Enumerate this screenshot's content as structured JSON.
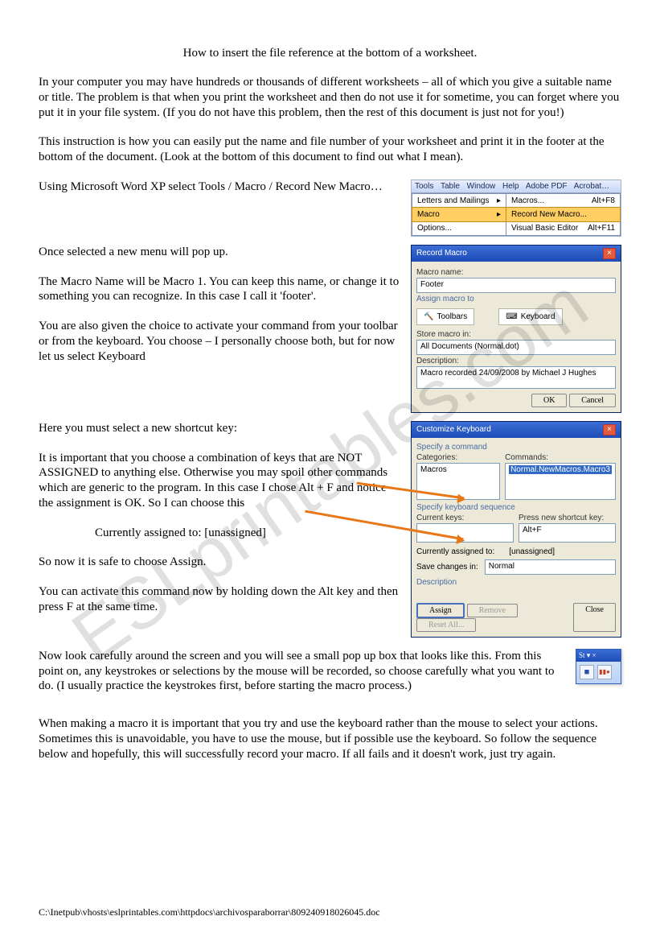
{
  "title": "How to insert the file reference at the bottom of a worksheet.",
  "p1": "In your computer you may have hundreds or thousands of different worksheets – all of which you give a suitable name or title.  The problem is that when you print the worksheet and then do not use it for sometime, you can forget where you put it in your file system.  (If you do not have this problem, then the rest of this document is just not for you!)",
  "p2": "This instruction is how you can easily put the name and file number of your worksheet and print it in the footer at the bottom of the document. (Look at the bottom of this document to find out what I mean).",
  "p3": "Using Microsoft Word XP select Tools / Macro / Record New Macro…",
  "p4": "Once selected a new menu will pop up.",
  "p5": "The Macro Name will be Macro 1.  You can keep this name, or change it to something you can recognize.  In this case I call it 'footer'.",
  "p6": "You are also given the choice to activate your command from your toolbar or from the keyboard.  You choose – I personally choose both, but for now let us select Keyboard",
  "p7": "Here you must select a new shortcut key:",
  "p8": "It is important that you choose a combination of keys that are NOT ASSIGNED to anything else.  Otherwise you may spoil other commands which are generic to the program.  In this case I chose Alt + F and notice the assignment is OK.  So I can choose this",
  "p8b": "Currently assigned to:  [unassigned]",
  "p9": "So now it is safe to choose Assign.",
  "p10": "You can activate this command now by holding down the Alt key and then press F at the same time.",
  "p11": "Now look carefully around the screen and you will see a small pop up box that looks like this.  From this point on, any keystrokes or selections by the mouse will be recorded, so choose carefully what you want to do. (I usually practice the keystrokes first, before starting the macro process.)",
  "p12": "When making a macro it is important that you try and use the keyboard rather than the mouse to select your actions.  Sometimes this is unavoidable, you have to use the mouse, but if possible use the keyboard.  So follow the sequence below and hopefully, this will successfully record your macro.  If all fails and it doesn't work, just try again.",
  "footer_path": "C:\\Inetpub\\vhosts\\eslprintables.com\\httpdocs\\archivosparaborrar\\809240918026045.doc",
  "watermark": "ESLprintables.com",
  "shot1": {
    "menubar": [
      "Tools",
      "Table",
      "Window",
      "Help",
      "Adobe PDF",
      "Acrobat…"
    ],
    "menu": [
      {
        "label": "Letters and Mailings",
        "arrow": "▸"
      },
      {
        "label": "Macro",
        "arrow": "▸",
        "hl": true
      },
      {
        "label": "Options..."
      }
    ],
    "submenu": [
      {
        "label": "Macros...",
        "sc": "Alt+F8"
      },
      {
        "label": "Record New Macro...",
        "hl": true
      },
      {
        "label": "Visual Basic Editor",
        "sc": "Alt+F11"
      }
    ]
  },
  "shot2": {
    "title": "Record Macro",
    "macro_name_label": "Macro name:",
    "macro_name_value": "Footer",
    "assign_label": "Assign macro to",
    "toolbars": "Toolbars",
    "keyboard": "Keyboard",
    "store_label": "Store macro in:",
    "store_value": "All Documents (Normal.dot)",
    "desc_label": "Description:",
    "desc_value": "Macro recorded 24/09/2008 by Michael J Hughes",
    "ok": "OK",
    "cancel": "Cancel"
  },
  "shot3": {
    "title": "Customize Keyboard",
    "specify": "Specify a command",
    "categories_label": "Categories:",
    "categories_value": "Macros",
    "commands_label": "Commands:",
    "commands_value": "Normal.NewMacros.Macro3",
    "specify_seq": "Specify keyboard sequence",
    "current_keys_label": "Current keys:",
    "press_label": "Press new shortcut key:",
    "press_value": "Alt+F",
    "assigned_label": "Currently assigned to:",
    "assigned_value": "[unassigned]",
    "save_label": "Save changes in:",
    "save_value": "Normal",
    "desc_label": "Description",
    "assign": "Assign",
    "remove": "Remove",
    "reset": "Reset All...",
    "close": "Close"
  },
  "shot4": {
    "title": "St ▾ ×",
    "stop_icon": "■",
    "pause_icon": "▮▮●"
  }
}
